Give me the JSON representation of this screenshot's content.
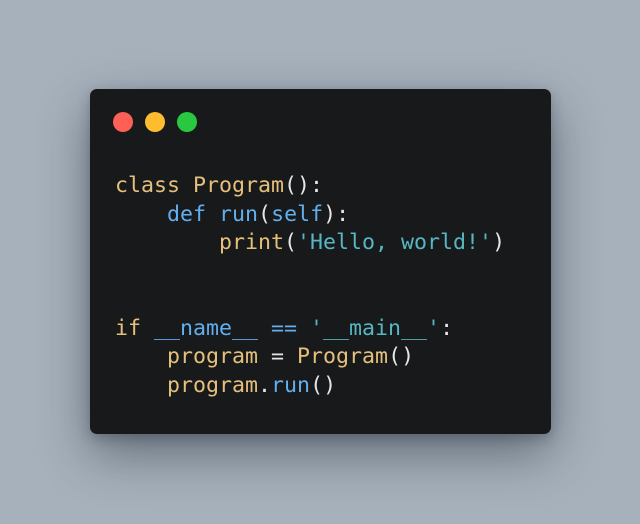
{
  "colors": {
    "background": "#a6b1bc",
    "window": "#18191b",
    "dot_red": "#fe5f57",
    "dot_yellow": "#febc2e",
    "dot_green": "#28c840",
    "keyword": "#e5c07b",
    "function": "#61afef",
    "string": "#56b6c2",
    "punctuation": "#e6e6e6",
    "identifier": "#e5c07b"
  },
  "window_controls": [
    "close",
    "minimize",
    "maximize"
  ],
  "code": {
    "lines": [
      [
        {
          "text": "class ",
          "kind": "keyword"
        },
        {
          "text": "Program",
          "kind": "identifier"
        },
        {
          "text": "():",
          "kind": "punctuation"
        }
      ],
      [
        {
          "text": "    ",
          "kind": "punctuation"
        },
        {
          "text": "def ",
          "kind": "function"
        },
        {
          "text": "run",
          "kind": "function"
        },
        {
          "text": "(",
          "kind": "punctuation"
        },
        {
          "text": "self",
          "kind": "function"
        },
        {
          "text": "):",
          "kind": "punctuation"
        }
      ],
      [
        {
          "text": "        ",
          "kind": "punctuation"
        },
        {
          "text": "print",
          "kind": "identifier"
        },
        {
          "text": "(",
          "kind": "punctuation"
        },
        {
          "text": "'Hello, world!'",
          "kind": "string"
        },
        {
          "text": ")",
          "kind": "punctuation"
        }
      ],
      [],
      [],
      [
        {
          "text": "if ",
          "kind": "keyword"
        },
        {
          "text": "__name__",
          "kind": "function"
        },
        {
          "text": " == ",
          "kind": "function"
        },
        {
          "text": "'__main__'",
          "kind": "string"
        },
        {
          "text": ":",
          "kind": "punctuation"
        }
      ],
      [
        {
          "text": "    ",
          "kind": "punctuation"
        },
        {
          "text": "program",
          "kind": "identifier"
        },
        {
          "text": " = ",
          "kind": "punctuation"
        },
        {
          "text": "Program",
          "kind": "identifier"
        },
        {
          "text": "()",
          "kind": "punctuation"
        }
      ],
      [
        {
          "text": "    ",
          "kind": "punctuation"
        },
        {
          "text": "program",
          "kind": "identifier"
        },
        {
          "text": ".",
          "kind": "punctuation"
        },
        {
          "text": "run",
          "kind": "function"
        },
        {
          "text": "()",
          "kind": "punctuation"
        }
      ]
    ]
  }
}
